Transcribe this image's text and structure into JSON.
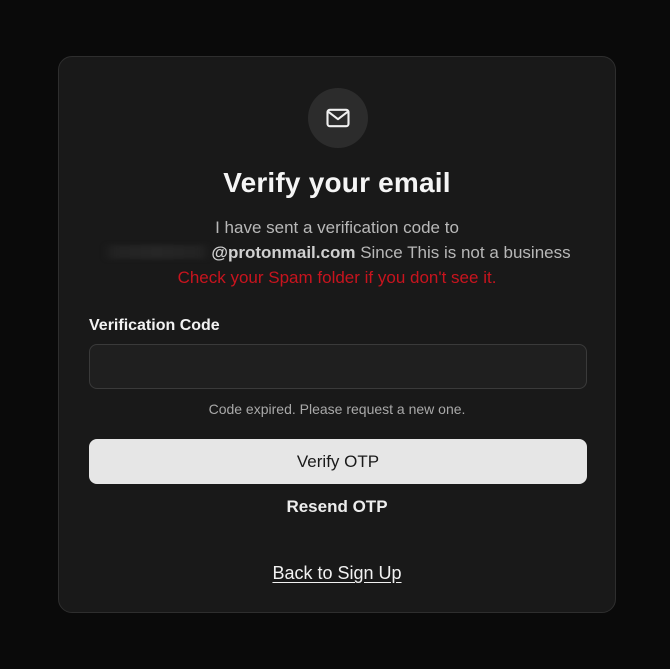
{
  "header": {
    "icon": "mail-icon",
    "title": "Verify your email"
  },
  "message": {
    "line1": "I have sent a verification code to",
    "email_domain": "@protonmail.com",
    "line2_suffix": " Since This is not a business",
    "warning": "Check your Spam folder if you don't see it."
  },
  "form": {
    "label": "Verification Code",
    "code_value": "",
    "code_placeholder": "",
    "status": "Code expired. Please request a new one."
  },
  "actions": {
    "verify_label": "Verify OTP",
    "resend_label": "Resend OTP",
    "back_label": "Back to Sign Up"
  },
  "colors": {
    "background": "#0a0a0a",
    "card": "#191919",
    "warning": "#c8141e",
    "button": "#e6e6e6"
  }
}
